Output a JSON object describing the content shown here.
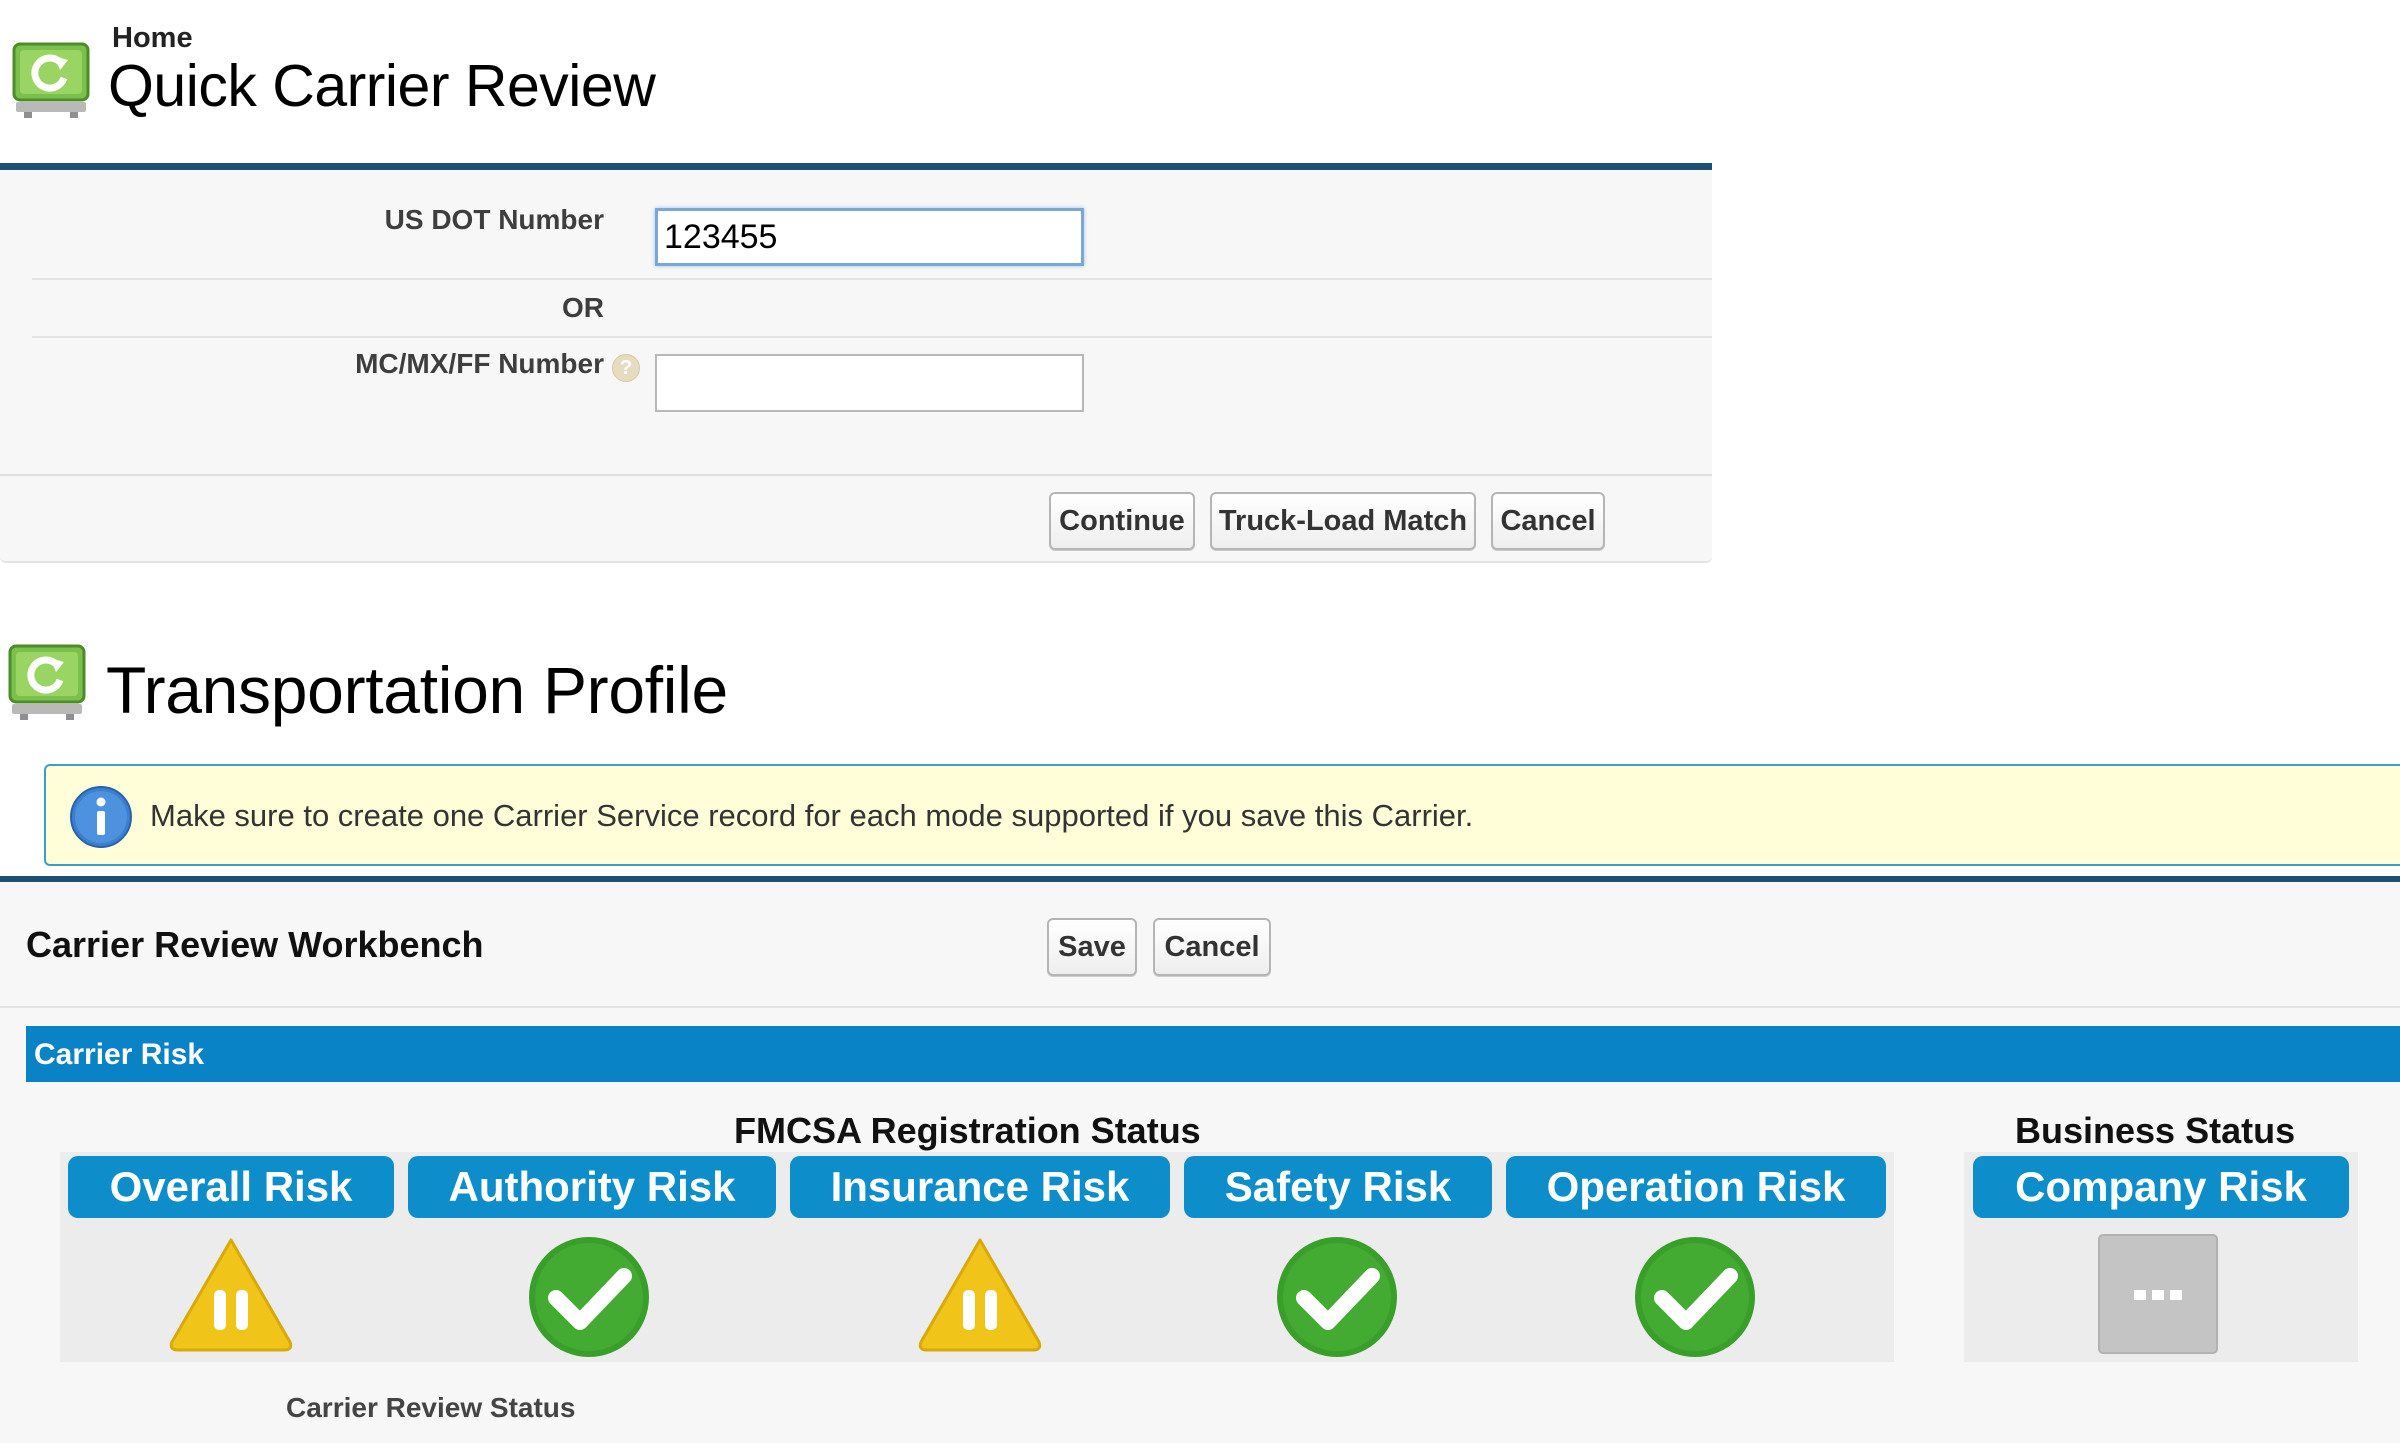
{
  "quick_review": {
    "breadcrumb": "Home",
    "title": "Quick Carrier Review",
    "usdot_label": "US DOT Number",
    "usdot_value": "123455",
    "or_label": "OR",
    "mc_label": "MC/MX/FF Number",
    "mc_value": "",
    "help_icon": "help-icon",
    "buttons": {
      "continue": "Continue",
      "truckload": "Truck-Load Match",
      "cancel": "Cancel"
    }
  },
  "profile": {
    "title": "Transportation Profile",
    "info_message": "Make sure to create one Carrier Service record for each mode supported if you save this Carrier.",
    "workbench_title": "Carrier Review Workbench",
    "buttons": {
      "save": "Save",
      "cancel": "Cancel"
    },
    "section_title": "Carrier Risk",
    "fmcsa_group_title": "FMCSA Registration Status",
    "business_group_title": "Business Status",
    "risks": [
      {
        "label": "Overall Risk",
        "status": "warning"
      },
      {
        "label": "Authority Risk",
        "status": "ok"
      },
      {
        "label": "Insurance Risk",
        "status": "warning"
      },
      {
        "label": "Safety Risk",
        "status": "ok"
      },
      {
        "label": "Operation Risk",
        "status": "ok"
      }
    ],
    "company_risk": {
      "label": "Company Risk",
      "status": "pending"
    },
    "review_status_label": "Carrier Review Status"
  },
  "colors": {
    "accent_blue": "#0e8dcb",
    "header_border": "#1c4f72",
    "warning": "#f0c419",
    "ok": "#3a9e2a",
    "pending": "#c4c4c4",
    "info_bg": "#fffed8"
  }
}
